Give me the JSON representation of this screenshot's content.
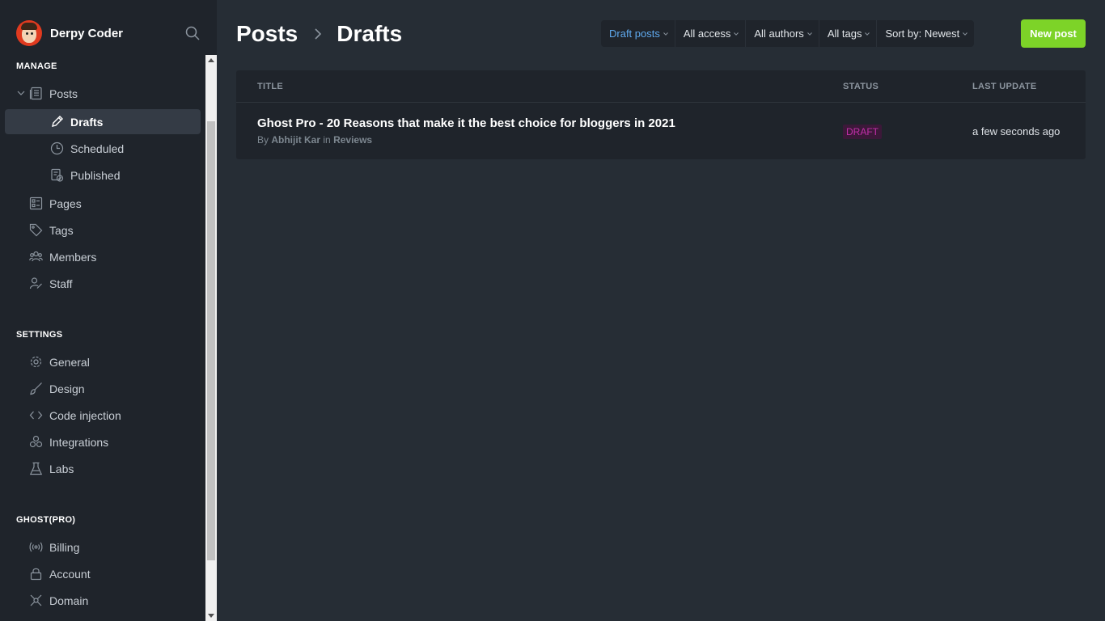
{
  "brand": {
    "name": "Derpy Coder",
    "avatar_icon": "derpy-avatar-icon",
    "accent": "#e03a1f"
  },
  "sidebar": {
    "manage_label": "MANAGE",
    "manage_items": [
      {
        "label": "Posts",
        "icon": "posts-icon"
      },
      {
        "label": "Drafts",
        "icon": "pencil-icon",
        "active": true
      },
      {
        "label": "Scheduled",
        "icon": "clock-icon"
      },
      {
        "label": "Published",
        "icon": "published-icon"
      },
      {
        "label": "Pages",
        "icon": "pages-icon"
      },
      {
        "label": "Tags",
        "icon": "tag-icon"
      },
      {
        "label": "Members",
        "icon": "members-icon"
      },
      {
        "label": "Staff",
        "icon": "staff-icon"
      }
    ],
    "settings_label": "SETTINGS",
    "settings_items": [
      {
        "label": "General",
        "icon": "gear-icon"
      },
      {
        "label": "Design",
        "icon": "brush-icon"
      },
      {
        "label": "Code injection",
        "icon": "code-icon"
      },
      {
        "label": "Integrations",
        "icon": "integrations-icon"
      },
      {
        "label": "Labs",
        "icon": "flask-icon"
      }
    ],
    "ghost_label": "GHOST(PRO)",
    "ghost_items": [
      {
        "label": "Billing",
        "icon": "billing-icon"
      },
      {
        "label": "Account",
        "icon": "lock-icon"
      },
      {
        "label": "Domain",
        "icon": "domain-icon"
      }
    ]
  },
  "header": {
    "crumb_root": "Posts",
    "crumb_current": "Drafts",
    "filters": [
      "Draft posts",
      "All access",
      "All authors",
      "All tags",
      "Sort by: Newest"
    ],
    "new_post_label": "New post",
    "new_post_color": "#7dd328",
    "filter_accent": "#5fa9ee"
  },
  "table": {
    "columns": [
      "TITLE",
      "STATUS",
      "LAST UPDATE"
    ],
    "rows": [
      {
        "title": "Ghost Pro - 20 Reasons that make it the best choice for bloggers in 2021",
        "by_prefix": "By",
        "author": "Abhijit Kar",
        "in_prefix": "in",
        "tag": "Reviews",
        "status": "DRAFT",
        "updated": "a few seconds ago"
      }
    ]
  }
}
